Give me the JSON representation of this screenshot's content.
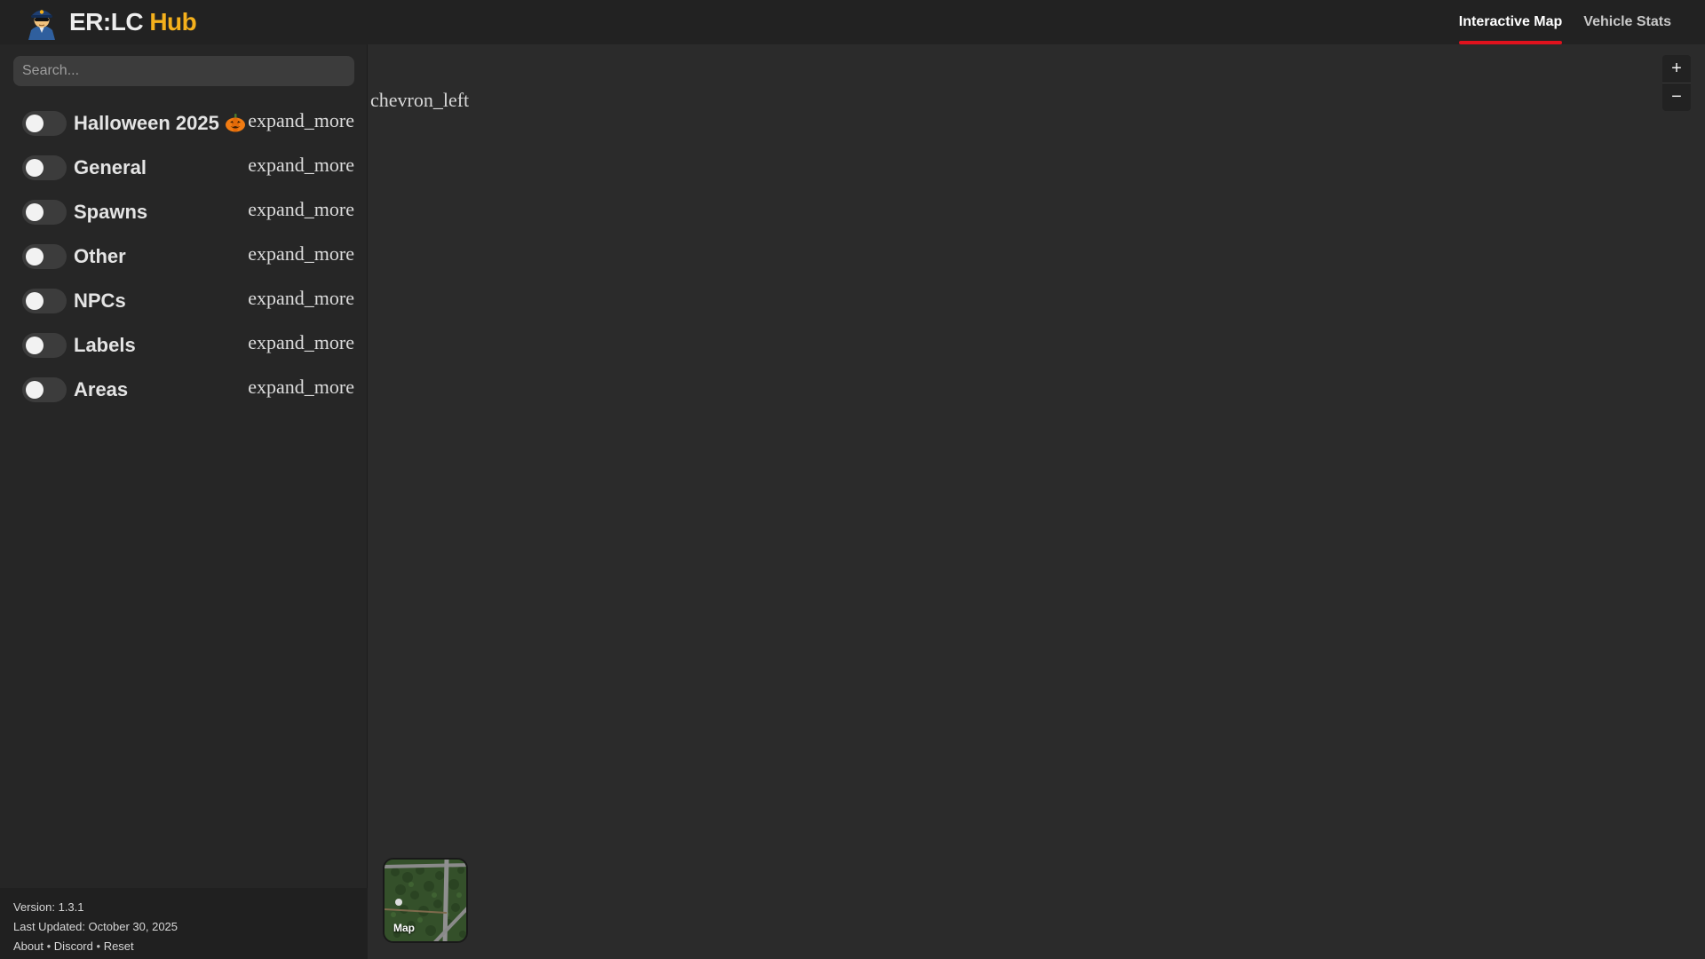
{
  "brand": {
    "name": "ER:LC",
    "accent": "Hub",
    "accent_color": "#f4b01c"
  },
  "nav": {
    "tabs": [
      {
        "label": "Interactive Map",
        "active": true
      },
      {
        "label": "Vehicle Stats",
        "active": false
      }
    ],
    "active_indicator_color": "#e0121d"
  },
  "sidebar": {
    "search_placeholder": "Search...",
    "expand_icon_text": "expand_more",
    "layers": [
      {
        "label": "Halloween 2025",
        "icon": "pumpkin-icon",
        "enabled": false
      },
      {
        "label": "General",
        "enabled": false
      },
      {
        "label": "Spawns",
        "enabled": false
      },
      {
        "label": "Other",
        "enabled": false
      },
      {
        "label": "NPCs",
        "enabled": false
      },
      {
        "label": "Labels",
        "enabled": false
      },
      {
        "label": "Areas",
        "enabled": false
      }
    ],
    "footer": {
      "version": "Version: 1.3.1",
      "last_updated": "Last Updated: October 30, 2025",
      "links": [
        "About",
        "Discord",
        "Reset"
      ],
      "separator": "•"
    }
  },
  "map": {
    "collapse_icon_text": "chevron_left",
    "zoom_in": "+",
    "zoom_out": "−",
    "minimap_label": "Map"
  }
}
